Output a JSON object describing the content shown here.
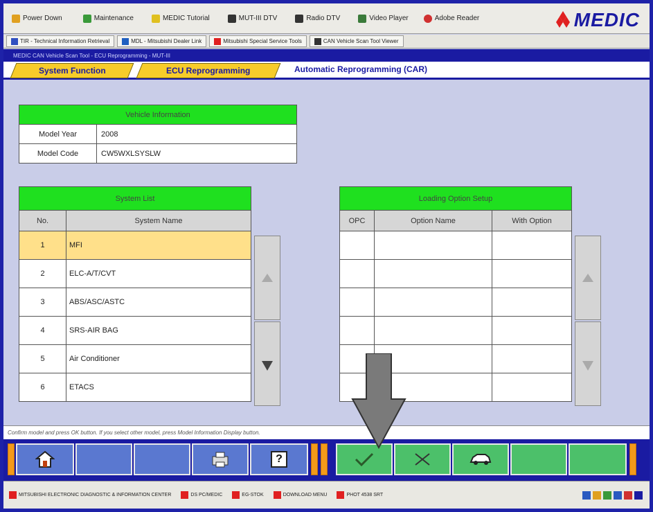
{
  "toolbar": {
    "items": [
      {
        "label": "Power Down",
        "icon": "power-icon",
        "color": "#e0a020"
      },
      {
        "label": "Maintenance",
        "icon": "wrench-icon",
        "color": "#3a9a3a"
      },
      {
        "label": "MEDIC Tutorial",
        "icon": "tutorial-icon",
        "color": "#e0c020"
      },
      {
        "label": "MUT-III DTV",
        "icon": "mut-icon",
        "color": "#333333"
      },
      {
        "label": "Radio DTV",
        "icon": "radio-icon",
        "color": "#333333"
      },
      {
        "label": "Video Player",
        "icon": "video-icon",
        "color": "#3a7a3a"
      },
      {
        "label": "Adobe Reader",
        "icon": "adobe-icon",
        "color": "#d03030"
      }
    ],
    "brand": "MEDIC",
    "brand_color": "#1a1ba2",
    "logo_color": "#e02020"
  },
  "tabs_row": {
    "items": [
      {
        "label": "TIR - Technical Information Retrieval",
        "color": "#3050c0"
      },
      {
        "label": "MDL - Mitsubishi Dealer Link",
        "color": "#2060c0"
      },
      {
        "label": "Mitsubishi Special Service Tools",
        "color": "#e02020"
      },
      {
        "label": "CAN Vehicle Scan Tool Viewer",
        "color": "#333333"
      }
    ]
  },
  "titlebar": {
    "text": "MEDIC  CAN Vehicle Scan Tool  -  ECU Reprogramming  -  MUT-III"
  },
  "function_tabs": {
    "tab1": "System Function",
    "tab2": "ECU Reprogramming",
    "active": "Automatic Reprogramming (CAR)"
  },
  "vehicle_info": {
    "header": "Vehicle Information",
    "rows": [
      {
        "label": "Model Year",
        "value": "2008"
      },
      {
        "label": "Model Code",
        "value": "CW5WXLSYSLW"
      }
    ]
  },
  "system_list": {
    "header": "System List",
    "col_no": "No.",
    "col_name": "System Name",
    "rows": [
      {
        "no": "1",
        "name": "MFI"
      },
      {
        "no": "2",
        "name": "ELC-A/T/CVT"
      },
      {
        "no": "3",
        "name": "ABS/ASC/ASTC"
      },
      {
        "no": "4",
        "name": "SRS-AIR BAG"
      },
      {
        "no": "5",
        "name": "Air Conditioner"
      },
      {
        "no": "6",
        "name": "ETACS"
      }
    ],
    "selected_color": "#ffe08a"
  },
  "loading_option": {
    "header": "Loading Option Setup",
    "col_opc": "OPC",
    "col_option": "Option Name",
    "col_with": "With Option"
  },
  "status_message": {
    "text": "Confirm model and press OK button. If you select other model, press Model Information Display button."
  },
  "buttons": {
    "home": "home-icon",
    "print": "print-icon",
    "help_label": "?",
    "ok": "checkmark-icon",
    "cancel": "cancel-icon",
    "vehicle": "car-icon"
  },
  "taskbar": {
    "items": [
      {
        "label": "MITSUBISHI ELECTRONIC DIAGNOSTIC & INFORMATION CENTER"
      },
      {
        "label": "DS PC/MEDIC"
      },
      {
        "label": "EG-STOK"
      },
      {
        "label": "DOWNLOAD MENU"
      },
      {
        "label": "PHOT 4538 SRT"
      }
    ]
  }
}
